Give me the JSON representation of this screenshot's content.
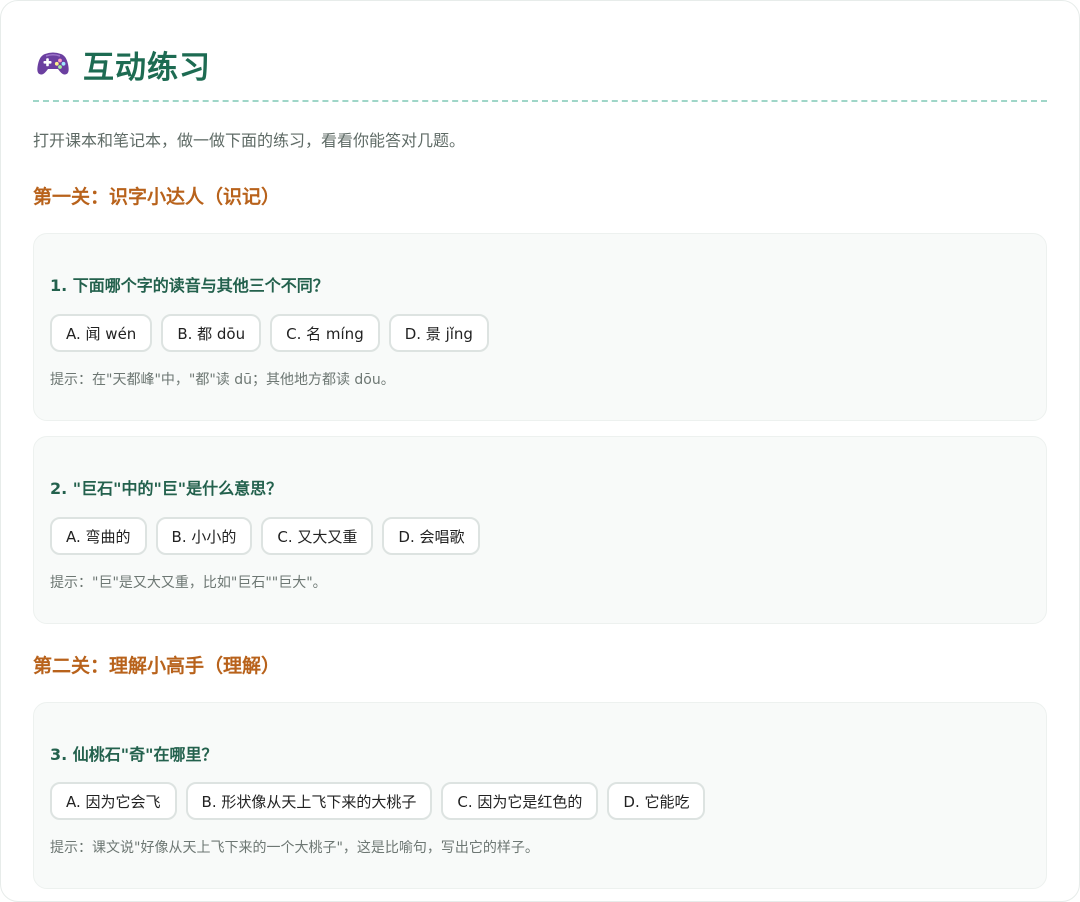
{
  "header": {
    "icon": "gamepad-icon",
    "title": "互动练习"
  },
  "intro": "打开课本和笔记本，做一做下面的练习，看看你能答对几题。",
  "levels": [
    {
      "title": "第一关：识字小达人（识记）"
    },
    {
      "title": "第二关：理解小高手（理解）"
    }
  ],
  "questions": [
    {
      "text": "1. 下面哪个字的读音与其他三个不同？",
      "options": [
        "A. 闻 wén",
        "B. 都 dōu",
        "C. 名 míng",
        "D. 景 jǐng"
      ],
      "hint": "提示：在\"天都峰\"中，\"都\"读 dū；其他地方都读 dōu。"
    },
    {
      "text": "2. \"巨石\"中的\"巨\"是什么意思？",
      "options": [
        "A. 弯曲的",
        "B. 小小的",
        "C. 又大又重",
        "D. 会唱歌"
      ],
      "hint": "提示：\"巨\"是又大又重，比如\"巨石\"\"巨大\"。"
    },
    {
      "text": "3. 仙桃石\"奇\"在哪里？",
      "options": [
        "A. 因为它会飞",
        "B. 形状像从天上飞下来的大桃子",
        "C. 因为它是红色的",
        "D. 它能吃"
      ],
      "hint": "提示：课文说\"好像从天上飞下来的一个大桃子\"，这是比喻句，写出它的样子。"
    }
  ],
  "colors": {
    "title": "#1d6b52",
    "level": "#b8621b",
    "question": "#23614d",
    "divider": "#9fd6c8"
  }
}
